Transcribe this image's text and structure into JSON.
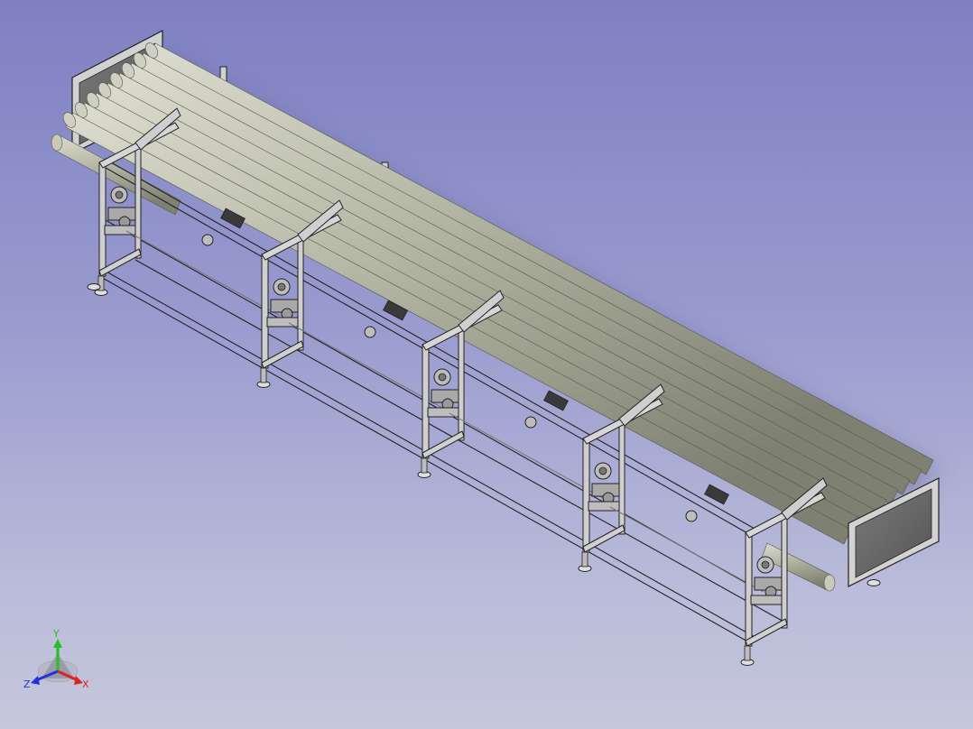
{
  "viewer": {
    "background_top": "#7e80c2",
    "background_bottom": "#c6c7dc"
  },
  "model": {
    "object": "roller-conveyor-assembly",
    "roller_count": 8,
    "support_stations": 5,
    "colors": {
      "roller": "#b9bba8",
      "roller_shade": "#8a8c7c",
      "frame": "#c9c9c9",
      "frame_edge": "#2a2a2a",
      "end_panel": "#6c6c6c"
    }
  },
  "triad": {
    "y_label": "Y",
    "z_label": "Z",
    "x_label": "X",
    "y_color": "#22c022",
    "z_color": "#2233dd",
    "x_color": "#dd2222"
  }
}
